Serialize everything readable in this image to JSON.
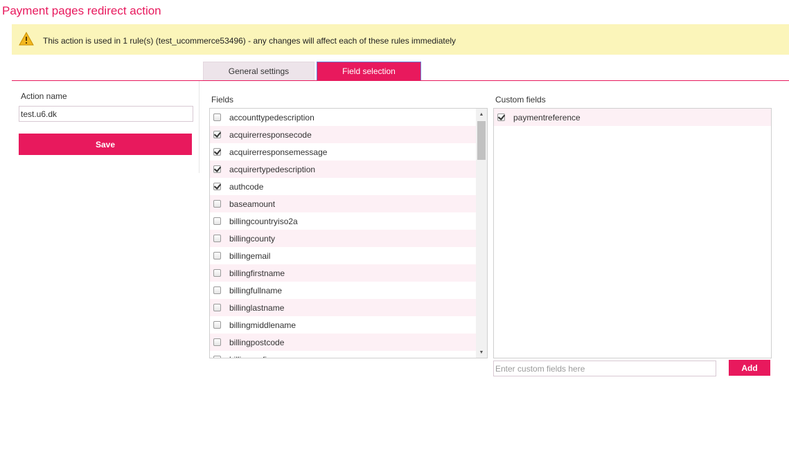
{
  "page": {
    "title": "Payment pages redirect action"
  },
  "warning": {
    "icon": "warning-icon",
    "text": "This action is used in 1 rule(s) (test_ucommerce53496) - any changes will affect each of these rules immediately"
  },
  "tabs": [
    {
      "label": "General settings",
      "active": false
    },
    {
      "label": "Field selection",
      "active": true
    }
  ],
  "action": {
    "label": "Action name",
    "value": "test.u6.dk",
    "save_label": "Save"
  },
  "fields": {
    "label": "Fields",
    "items": [
      {
        "name": "accounttypedescription",
        "checked": false
      },
      {
        "name": "acquirerresponsecode",
        "checked": true
      },
      {
        "name": "acquirerresponsemessage",
        "checked": true
      },
      {
        "name": "acquirertypedescription",
        "checked": true
      },
      {
        "name": "authcode",
        "checked": true
      },
      {
        "name": "baseamount",
        "checked": false
      },
      {
        "name": "billingcountryiso2a",
        "checked": false
      },
      {
        "name": "billingcounty",
        "checked": false
      },
      {
        "name": "billingemail",
        "checked": false
      },
      {
        "name": "billingfirstname",
        "checked": false
      },
      {
        "name": "billingfullname",
        "checked": false
      },
      {
        "name": "billinglastname",
        "checked": false
      },
      {
        "name": "billingmiddlename",
        "checked": false
      },
      {
        "name": "billingpostcode",
        "checked": false
      },
      {
        "name": "billingprefix",
        "checked": false
      }
    ]
  },
  "custom": {
    "label": "Custom fields",
    "items": [
      {
        "name": "paymentreference",
        "checked": true
      }
    ],
    "placeholder": "Enter custom fields here",
    "add_label": "Add"
  },
  "colors": {
    "accent": "#e8195d",
    "warning_bg": "#fbf5ba",
    "row_alt": "#fdf0f5"
  }
}
